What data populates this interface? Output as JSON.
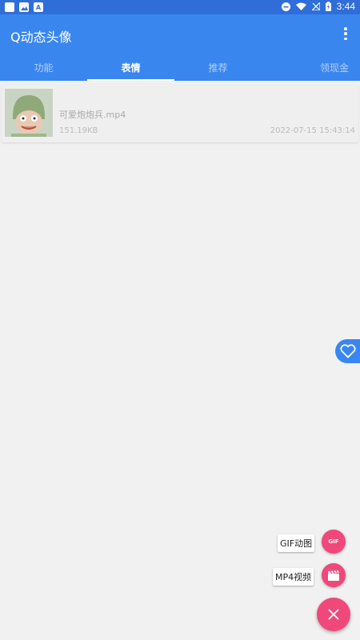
{
  "status_bar": {
    "time": "3:44",
    "left_icons": [
      "square-icon",
      "image-icon",
      "a-icon"
    ],
    "a_glyph": "A",
    "right_icons": [
      "dnd-icon",
      "wifi-icon",
      "no-signal-icon",
      "battery-icon"
    ]
  },
  "app_bar": {
    "title": "Q动态头像",
    "menu_icon": "more-vert-icon"
  },
  "tabs": [
    {
      "label": "功能",
      "active": false
    },
    {
      "label": "表情",
      "active": true
    },
    {
      "label": "推荐",
      "active": false
    },
    {
      "label": "领现金",
      "active": false
    }
  ],
  "files": [
    {
      "name": "可爱炮炮兵.mp4",
      "size": "151.19KB",
      "date": "2022-07-15 15:43:14"
    }
  ],
  "side_button": {
    "icon": "heart-icon"
  },
  "fab_menu": {
    "items": [
      {
        "label": "GIF动图",
        "icon_text": "GIF"
      },
      {
        "label": "MP4视频",
        "icon": "clapperboard-icon"
      }
    ],
    "main_icon": "close-icon"
  },
  "colors": {
    "primary": "#3a86ef",
    "status_bar": "#2f6ed9",
    "accent": "#f0487b",
    "background": "#f1f1f1"
  }
}
